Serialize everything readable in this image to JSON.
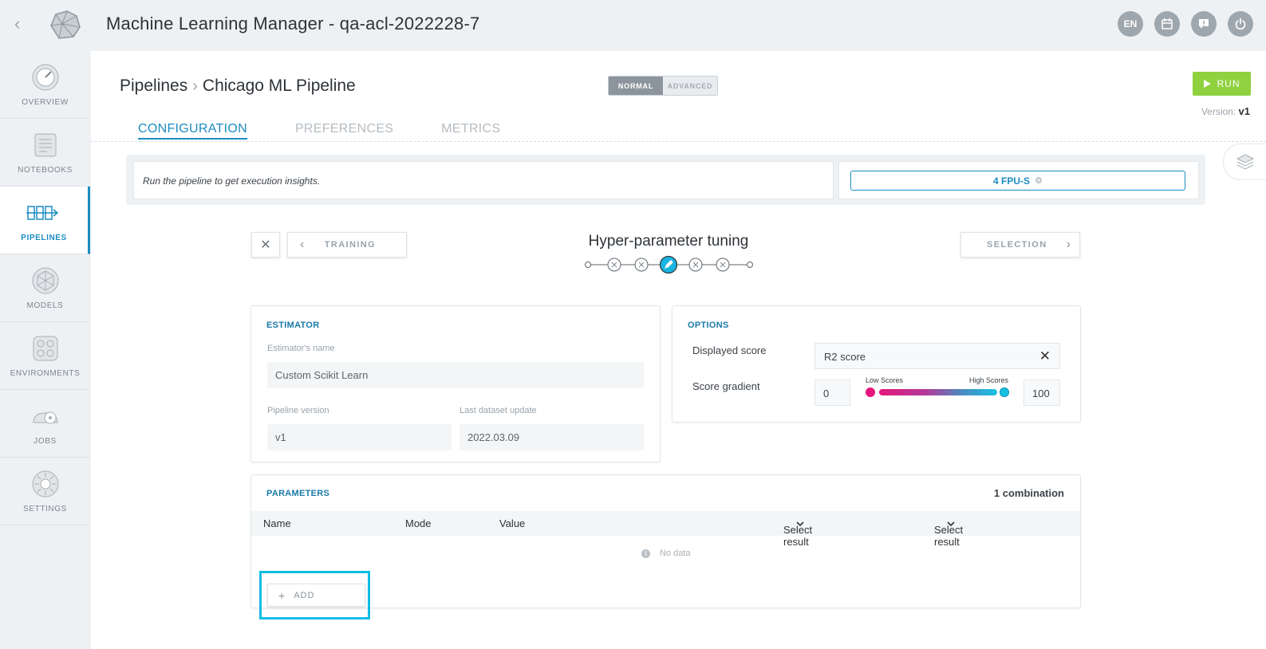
{
  "app": {
    "title": "Machine Learning Manager - qa-acl-2022228-7"
  },
  "topbar": {
    "language": "EN"
  },
  "sidebar": {
    "items": [
      {
        "label": "OVERVIEW"
      },
      {
        "label": "NOTEBOOKS"
      },
      {
        "label": "PIPELINES"
      },
      {
        "label": "MODELS"
      },
      {
        "label": "ENVIRONMENTS"
      },
      {
        "label": "JOBS"
      },
      {
        "label": "SETTINGS"
      }
    ]
  },
  "header": {
    "breadcrumb_root": "Pipelines",
    "breadcrumb_current": "Chicago ML Pipeline",
    "mode_normal": "NORMAL",
    "mode_advanced": "ADVANCED",
    "run_label": "RUN",
    "version_label": "Version:",
    "version_value": "v1"
  },
  "tabs": [
    {
      "label": "CONFIGURATION"
    },
    {
      "label": "PREFERENCES"
    },
    {
      "label": "METRICS"
    }
  ],
  "insights": {
    "message": "Run the pipeline to get execution insights.",
    "fpu_label": "4 FPU-S"
  },
  "step": {
    "title": "Hyper-parameter tuning",
    "prev_label": "TRAINING",
    "next_label": "SELECTION"
  },
  "estimator": {
    "title": "ESTIMATOR",
    "name_label": "Estimator's name",
    "name_value": "Custom Scikit Learn",
    "version_label": "Pipeline version",
    "version_value": "v1",
    "dataset_label": "Last dataset update",
    "dataset_value": "2022.03.09"
  },
  "options": {
    "title": "OPTIONS",
    "displayed_score_label": "Displayed score",
    "displayed_score_value": "R2 score",
    "gradient_label": "Score gradient",
    "gradient_min": "0",
    "gradient_max": "100",
    "low_label": "Low Scores",
    "high_label": "High Scores",
    "colors": {
      "low": "#e5177b",
      "high": "#18c1e4"
    }
  },
  "parameters": {
    "title": "PARAMETERS",
    "combinations": "1 combination",
    "columns": [
      "Name",
      "Mode",
      "Value",
      "Select result",
      "Select result"
    ],
    "empty_text": "No data",
    "add_label": "ADD"
  },
  "colors": {
    "accent": "#1b8cc1",
    "run": "#8fd13f",
    "highlight": "#10bde4"
  }
}
